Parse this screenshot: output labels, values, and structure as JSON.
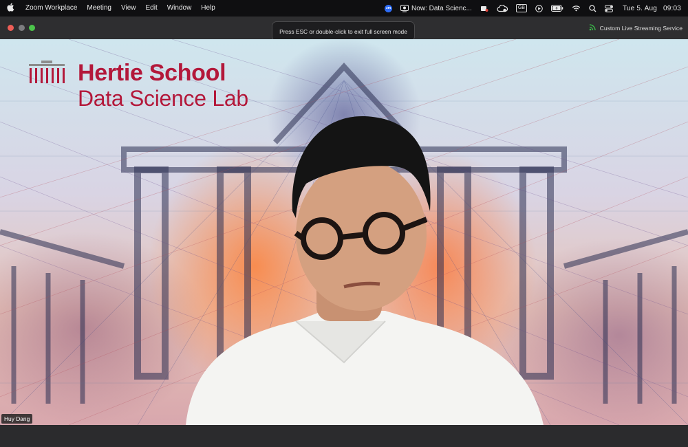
{
  "menubar": {
    "apple_icon": "apple-logo-icon",
    "items": [
      "Zoom Workplace",
      "Meeting",
      "View",
      "Edit",
      "Window",
      "Help"
    ],
    "tray": {
      "zoom_badge": "zm",
      "now_playing": "Now: Data Scienc...",
      "keyboard_layout": "GB",
      "date": "Tue 5. Aug",
      "time": "09:03"
    }
  },
  "window": {
    "fullscreen_hint": "Press ESC or double-click to exit full screen mode",
    "stream_status": "Custom Live Streaming Service",
    "colors": {
      "close": "#ee5e57",
      "minimize": "#7d7d80",
      "maximize": "#4cc54b",
      "stream": "#3ac24a"
    }
  },
  "video": {
    "logo": {
      "title": "Hertie School",
      "subtitle": "Data Science Lab",
      "color": "#b3183a"
    },
    "participant_name": "Huy Dang"
  }
}
